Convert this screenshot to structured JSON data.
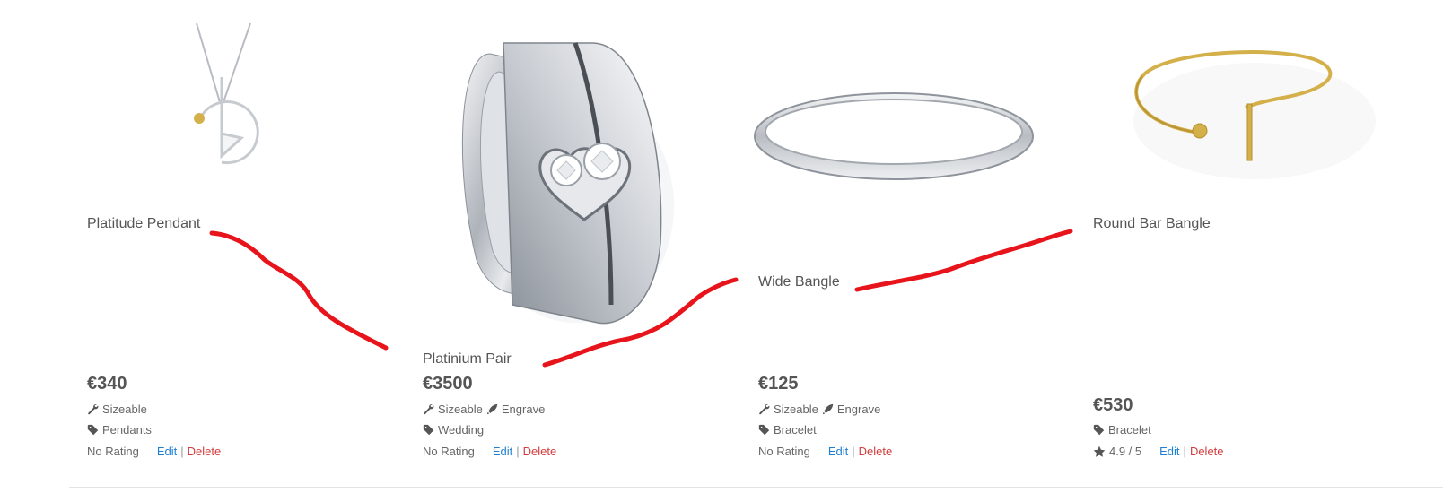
{
  "products": [
    {
      "name": "Platitude Pendant",
      "price": "€340",
      "features": [
        "Sizeable"
      ],
      "category": "Pendants",
      "rating": "No Rating",
      "edit_label": "Edit",
      "delete_label": "Delete"
    },
    {
      "name": "Platinium Pair",
      "price": "€3500",
      "features": [
        "Sizeable",
        "Engrave"
      ],
      "category": "Wedding",
      "rating": "No Rating",
      "edit_label": "Edit",
      "delete_label": "Delete"
    },
    {
      "name": "Wide Bangle",
      "price": "€125",
      "features": [
        "Sizeable",
        "Engrave"
      ],
      "category": "Bracelet",
      "rating": "No Rating",
      "edit_label": "Edit",
      "delete_label": "Delete"
    },
    {
      "name": "Round Bar Bangle",
      "price": "€530",
      "features": [],
      "category": "Bracelet",
      "rating": "4.9 / 5",
      "edit_label": "Edit",
      "delete_label": "Delete"
    }
  ],
  "separator": "|",
  "icons": {
    "feature": "wrench-icon",
    "engrave": "pen-nib-icon",
    "category": "tag-icon",
    "rating": "star-icon"
  },
  "colors": {
    "edit_link": "#1f7fd1",
    "delete_link": "#d23c3c",
    "annotation": "#e8141b",
    "gold": "#d4b04a",
    "silver": "#c8ccd2"
  }
}
